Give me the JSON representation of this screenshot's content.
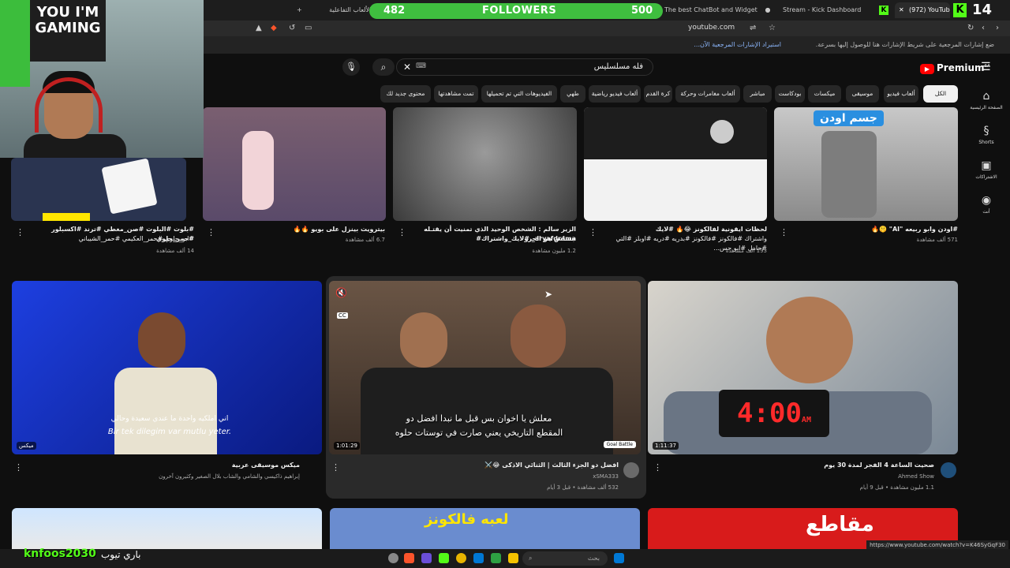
{
  "browser": {
    "tabs": [
      {
        "label": "+",
        "active": false
      },
      {
        "label": "لعبة الألعاب التفاعلية",
        "active": false
      },
      {
        "label": "The best ChatBot and Widgets for Ki",
        "active": false
      },
      {
        "label": "Stream - Kick Dashboard",
        "active": false
      },
      {
        "label": "(972) YouTube",
        "active": true
      }
    ],
    "url": "youtube.com",
    "bookmarks_text": "ضع إشارات المرجعية على شريط الإشارات هنا للوصول إليها بسرعة.",
    "bookmarks_link": "استيراد الإشارات المرجعية الآن...",
    "status_url": "https://www.youtube.com/watch?v=K46SyGqF30"
  },
  "overlay": {
    "followers_label": "FOLLOWERS",
    "followers_current": "482",
    "followers_goal": "500",
    "kick_count": "14",
    "kick_name": "knfoos2030",
    "brand_text": "باري تيوب",
    "poster_text": "YOU I'M GAMING"
  },
  "youtube": {
    "logo": "Premium",
    "region": "SA",
    "search_query": "فله مسلسليس",
    "chips": [
      "الكل",
      "ألعاب فيديو",
      "موسيقى",
      "ميكسات",
      "بودكاست",
      "مباشر",
      "ألعاب مغامرات وحركة",
      "كرة القدم",
      "ألعاب فيديو رياضية",
      "طهي",
      "الفيديوهات التي تم تحميلها مؤخرًا",
      "تمت مشاهدتها",
      "محتوى جديد لك"
    ],
    "sidebar": [
      {
        "label": "الصفحة الرئيسية",
        "icon": "home-icon"
      },
      {
        "label": "Shorts",
        "icon": "shorts-icon"
      },
      {
        "label": "الاشتراكات",
        "icon": "subscriptions-icon"
      },
      {
        "label": "أنت",
        "icon": "account-icon"
      }
    ],
    "row1": [
      {
        "title": "#اودن وابو ربيعه \"AI\" 🤫🔥",
        "views": "571 ألف مشاهدة",
        "overlay": "جسم اودن"
      },
      {
        "title": "لحظات ايقونية لفالكونز 😂🔥 #لايك",
        "title2": "واشتراك #فالكونز #فالكونز #بدريه #دريه #اوبلز #التي #حامل #ابو حس...",
        "views": "193 ألف مشاهدة"
      },
      {
        "title": "الزير سالم : الشخص الوحيد الذي تمنيت أن يقتـله جساس هو الجرو",
        "title2": "aryafdrama_ #لايك_واشتراك#",
        "views": "1.2 مليون مشاهدة"
      },
      {
        "title": "بيترويت بينزل على بويو 🔥🔥",
        "views": "6.7 ألف مشاهدة"
      },
      {
        "title": "#بلوت #البلوت #صن_مغطي #ترند #اكسبلور #حمر_جلوي",
        "title2": "#ابو_جلوي #حمر_العكيمي #حمر_الشيباني",
        "views": "14 ألف مشاهدة"
      }
    ],
    "row2": [
      {
        "title": "صحيت الساعة 4 الفجر لمدة 30 يوم",
        "channel": "Ahmed Show",
        "meta": "1.1 مليون مشاهدة • قبل 9 أيام",
        "duration": "1:11:37",
        "clock": "4:00",
        "clock_am": "AM"
      },
      {
        "title": "افضل دو الجزء الثالث | الثنائي الاذكى 😂⚔️",
        "channel": "xSMA333",
        "meta": "532 ألف مشاهدة • قبل 3 أيام",
        "duration": "1:01:29",
        "subtitle1": "معلش يا اخوان بس قبل ما نبدا افضل دو",
        "subtitle2": "المقطع التاريخي يعني صارت في توستات حلوه",
        "badge": "Goal Battle"
      },
      {
        "title": "ميكس موسيقى عربية",
        "meta": "إبراهيم ذاكيسي والشامي والشاب بلال الصغير وكثيرون آخرون",
        "subtitle1": "اني املكيه واحدة ما عندي سعيدة وحالي",
        "subtitle2": "Bir tek dilegim var mutlu yeter.",
        "mix_label": "ميكس"
      }
    ],
    "row3_overlays": [
      "مقاطع",
      "لعبه فالكونز"
    ]
  },
  "taskbar": {
    "search_placeholder": "بحث"
  }
}
